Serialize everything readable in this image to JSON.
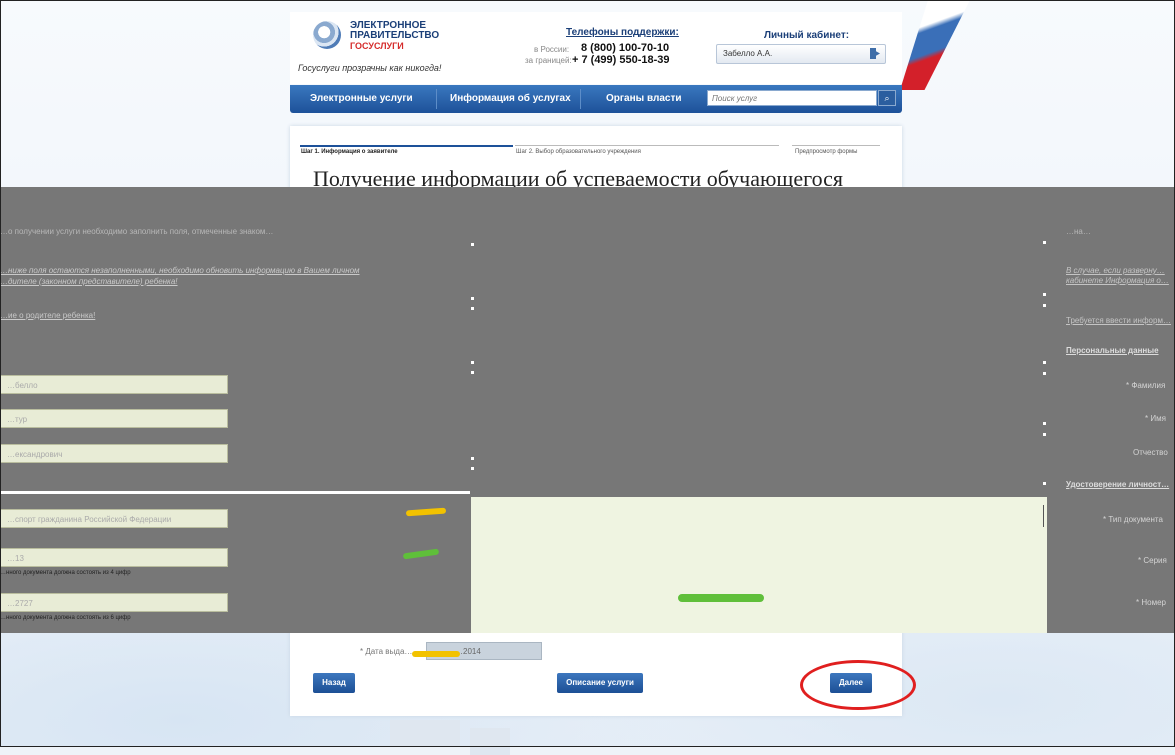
{
  "header": {
    "logo_line1": "ЭЛЕКТРОННОЕ",
    "logo_line2": "ПРАВИТЕЛЬСТВО",
    "logo_line3": "ГОСУСЛУГИ",
    "slogan": "Госуслуги прозрачны как никогда!",
    "support_title": "Телефоны поддержки:",
    "support_russia_label": "в России:",
    "support_russia_number": "8 (800) 100-70-10",
    "support_abroad_label": "за границей:",
    "support_abroad_number": "+ 7 (499) 550-18-39",
    "cabinet_title": "Личный кабинет:",
    "cabinet_user": "Забелло А.А."
  },
  "nav": {
    "items": [
      "Электронные услуги",
      "Информация об услугах",
      "Органы власти"
    ],
    "search_placeholder": "Поиск услуг"
  },
  "steps": [
    "Шаг 1. Информация о заявителе",
    "Шаг 2. Выбор образовательного учреждения",
    "Предпросмотр формы"
  ],
  "page_title": "Получение информации об успеваемости обучающегося",
  "overlay_left": {
    "line1": "…о получении услуги необходимо заполнить поля, отмеченные знаком…",
    "info_line1": "…ниже поля остаются незаполненными, необходимо обновить информацию в Вашем личном",
    "info_line2": "…дителе (законном представителе) ребенка!",
    "info_parent": "…ие о родителе ребенка!",
    "fields": [
      "…белло",
      "…тур",
      "…ександрович",
      "…спорт гражданина Российской Федерации",
      "…13",
      "…2727"
    ],
    "hint": "…нного документа должна состоять из 4 цифр",
    "hint2": "…нного документа должна состоять из 6 цифр"
  },
  "overlay_right": {
    "top_line": "…на…",
    "info_line1": "В случае, если разверну…",
    "info_line2": "кабинете Информация о…",
    "requirement": "Требуется ввести информ…",
    "personal_data": "Персональные данные",
    "surname_label": "* Фамилия",
    "name_label": "* Имя",
    "patronymic_label": "Отчество",
    "identity_doc": "Удостоверение личност…",
    "doc_type_label": "* Тип документа",
    "series_label": "* Серия",
    "number_label": "* Номер"
  },
  "date_issued": {
    "label": "* Дата выда…",
    "value": "…2014"
  },
  "buttons": {
    "back": "Назад",
    "description": "Описание услуги",
    "next": "Далее"
  },
  "colors": {
    "nav_blue": "#1d5199",
    "highlight_red": "#e01f1f",
    "overlay_gray": "#777777",
    "scribble_green": "#5fbf3a",
    "scribble_yellow": "#f2c200"
  }
}
